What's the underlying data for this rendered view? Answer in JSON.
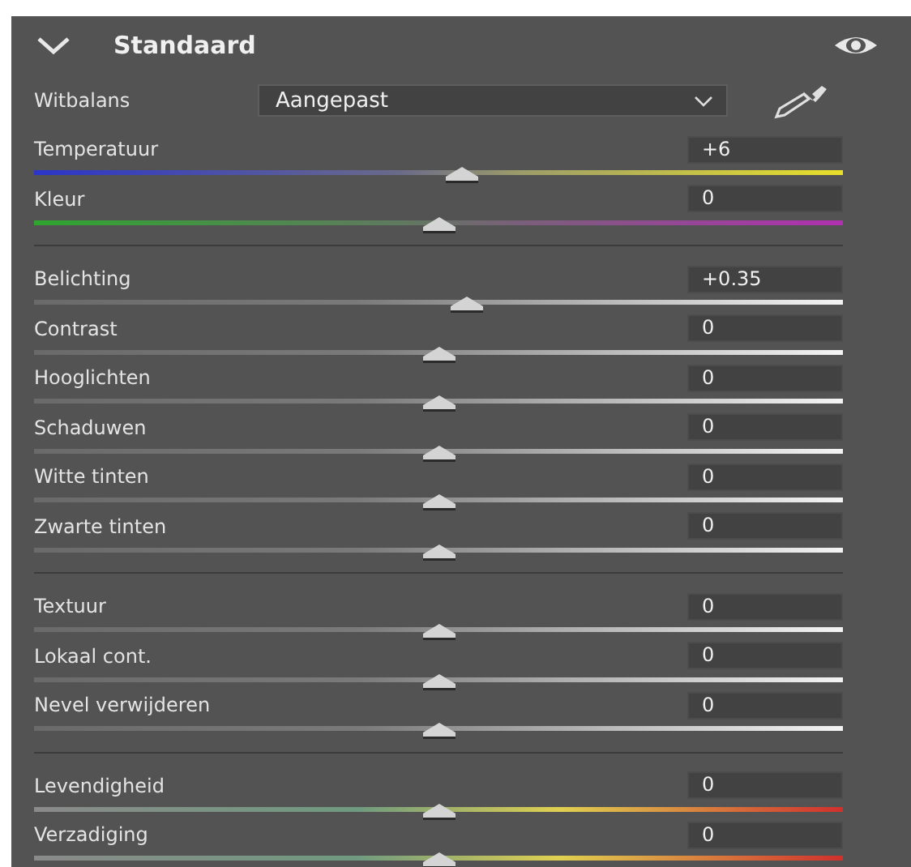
{
  "panel": {
    "title": "Standaard",
    "expanded": true
  },
  "white_balance": {
    "label": "Witbalans",
    "value": "Aangepast"
  },
  "sections": [
    {
      "sliders": [
        {
          "kind": "temperature",
          "label": "Temperatuur",
          "value": "+6",
          "level": 0.53
        },
        {
          "kind": "tint",
          "label": "Kleur",
          "value": "0",
          "level": 0.5
        }
      ]
    },
    {
      "sliders": [
        {
          "kind": "tone",
          "label": "Belichting",
          "value": "+0.35",
          "level": 0.535
        },
        {
          "kind": "tone",
          "label": "Contrast",
          "value": "0",
          "level": 0.5
        },
        {
          "kind": "tone",
          "label": "Hooglichten",
          "value": "0",
          "level": 0.5
        },
        {
          "kind": "tone",
          "label": "Schaduwen",
          "value": "0",
          "level": 0.5
        },
        {
          "kind": "tone",
          "label": "Witte tinten",
          "value": "0",
          "level": 0.5
        },
        {
          "kind": "tone",
          "label": "Zwarte tinten",
          "value": "0",
          "level": 0.5
        }
      ]
    },
    {
      "sliders": [
        {
          "kind": "tone",
          "label": "Textuur",
          "value": "0",
          "level": 0.5
        },
        {
          "kind": "tone",
          "label": "Lokaal cont.",
          "value": "0",
          "level": 0.5
        },
        {
          "kind": "tone",
          "label": "Nevel verwijderen",
          "value": "0",
          "level": 0.5
        }
      ]
    },
    {
      "sliders": [
        {
          "kind": "saturation",
          "label": "Levendigheid",
          "value": "0",
          "level": 0.5
        },
        {
          "kind": "saturation",
          "label": "Verzadiging",
          "value": "0",
          "level": 0.5
        }
      ]
    }
  ]
}
